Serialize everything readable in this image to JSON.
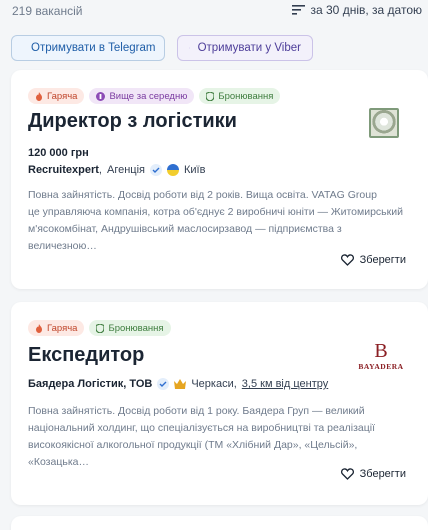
{
  "results": {
    "count_label": "219 вакансій",
    "sort_label": "за 30 днів, за датою"
  },
  "subscribe": {
    "telegram_label": "Отримувати в Telegram",
    "viber_label": "Отримувати у Viber"
  },
  "vacancies": [
    {
      "tags": [
        "Гаряча",
        "Вище за середню",
        "Бронювання"
      ],
      "title": "Директор з логістики",
      "salary": "120 000 грн",
      "company": "Recruitexpert",
      "company_type": "Агенція",
      "city": "Київ",
      "description_line1": "Повна зайнятість. Досвід роботи від 2 років. Вища освіта. VATAG Group",
      "description_line2": "це управляюча компанія, котра об'єднує 2 виробничі юніти — Житомирський",
      "description_line3": "м'ясокомбінат, Андрушівський маслосирзавод — підприємства з величезною…",
      "save_label": "Зберегти"
    },
    {
      "tags": [
        "Гаряча",
        "Бронювання"
      ],
      "title": "Експедитор",
      "company": "Баядера Логістик, ТОВ",
      "city": "Черкаси,",
      "distance": "3,5 км від центру",
      "logo_letter": "B",
      "logo_name": "BAYADERA",
      "description_line1": "Повна зайнятість. Досвід роботи від 1 року. Баядера Груп — великий",
      "description_line2": "національний холдинг, що спеціалізується на виробництві та реалізації",
      "description_line3": "високоякісної алкогольної продукції (ТМ «Хлібний Дар», «Цельсій», «Козацька…",
      "save_label": "Зберегти"
    }
  ],
  "colors": {
    "background": "#f4f6f8",
    "hot_tag": "#fde9e4",
    "salary_tag": "#f1e6f7",
    "reservation_tag": "#e6f4e6",
    "telegram": "#1f5ea8",
    "viber": "#4e3e9a"
  }
}
